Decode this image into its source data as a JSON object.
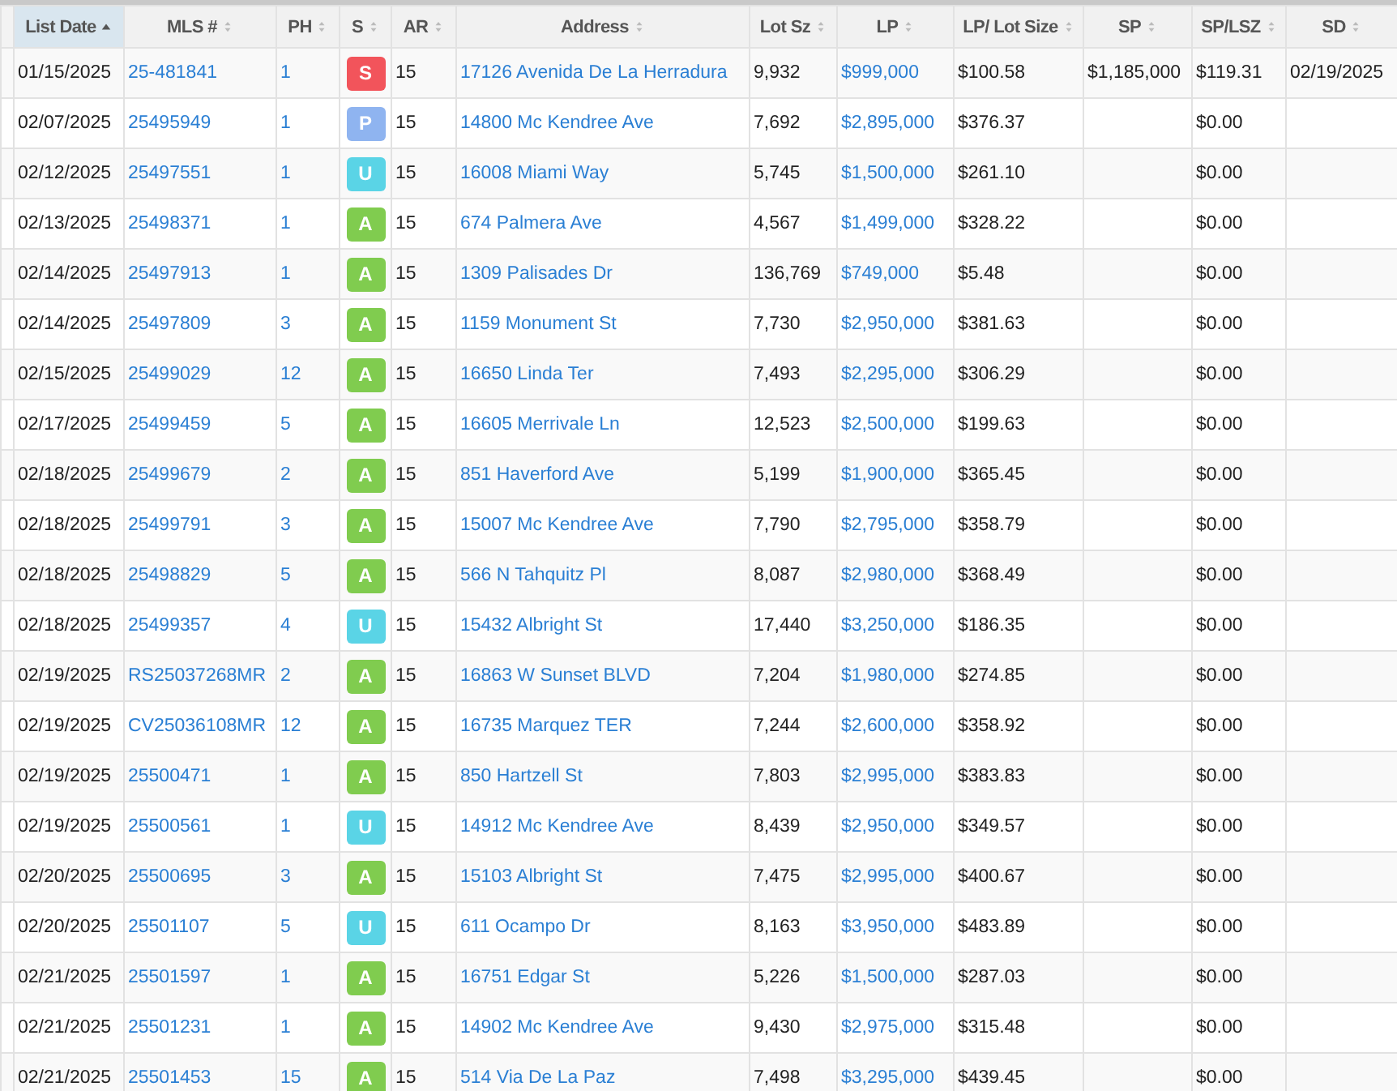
{
  "table": {
    "columns": [
      {
        "label": "List Date",
        "sorted": true
      },
      {
        "label": "MLS #",
        "sorted": false
      },
      {
        "label": "PH",
        "sorted": false
      },
      {
        "label": "S",
        "sorted": false
      },
      {
        "label": "AR",
        "sorted": false
      },
      {
        "label": "Address",
        "sorted": false
      },
      {
        "label": "Lot Sz",
        "sorted": false
      },
      {
        "label": "LP",
        "sorted": false
      },
      {
        "label": "LP/ Lot Size",
        "sorted": false
      },
      {
        "label": "SP",
        "sorted": false
      },
      {
        "label": "SP/LSZ",
        "sorted": false
      },
      {
        "label": "SD",
        "sorted": false
      }
    ],
    "rows": [
      {
        "list_date": "01/15/2025",
        "mls": "25-481841",
        "ph": "1",
        "status": "S",
        "color": "#f2545b",
        "ar": "15",
        "address": "17126 Avenida De La Herradura",
        "lot": "9,932",
        "lp": "$999,000",
        "lp_lot": "$100.58",
        "sp": "$1,185,000",
        "sp_lsz": "$119.31",
        "sd": "02/19/2025"
      },
      {
        "list_date": "02/07/2025",
        "mls": "25495949",
        "ph": "1",
        "status": "P",
        "color": "#8fb4f0",
        "ar": "15",
        "address": "14800 Mc Kendree Ave",
        "lot": "7,692",
        "lp": "$2,895,000",
        "lp_lot": "$376.37",
        "sp_lsz": "$0.00"
      },
      {
        "list_date": "02/12/2025",
        "mls": "25497551",
        "ph": "1",
        "status": "U",
        "color": "#5ad4e6",
        "ar": "15",
        "address": "16008 Miami Way",
        "lot": "5,745",
        "lp": "$1,500,000",
        "lp_lot": "$261.10",
        "sp_lsz": "$0.00"
      },
      {
        "list_date": "02/13/2025",
        "mls": "25498371",
        "ph": "1",
        "status": "A",
        "color": "#80cc4f",
        "ar": "15",
        "address": "674 Palmera Ave",
        "lot": "4,567",
        "lp": "$1,499,000",
        "lp_lot": "$328.22",
        "sp_lsz": "$0.00"
      },
      {
        "list_date": "02/14/2025",
        "mls": "25497913",
        "ph": "1",
        "status": "A",
        "color": "#80cc4f",
        "ar": "15",
        "address": "1309 Palisades Dr",
        "lot": "136,769",
        "lp": "$749,000",
        "lp_lot": "$5.48",
        "sp_lsz": "$0.00"
      },
      {
        "list_date": "02/14/2025",
        "mls": "25497809",
        "ph": "3",
        "status": "A",
        "color": "#80cc4f",
        "ar": "15",
        "address": "1159 Monument St",
        "lot": "7,730",
        "lp": "$2,950,000",
        "lp_lot": "$381.63",
        "sp_lsz": "$0.00"
      },
      {
        "list_date": "02/15/2025",
        "mls": "25499029",
        "ph": "12",
        "status": "A",
        "color": "#80cc4f",
        "ar": "15",
        "address": "16650 Linda Ter",
        "lot": "7,493",
        "lp": "$2,295,000",
        "lp_lot": "$306.29",
        "sp_lsz": "$0.00"
      },
      {
        "list_date": "02/17/2025",
        "mls": "25499459",
        "ph": "5",
        "status": "A",
        "color": "#80cc4f",
        "ar": "15",
        "address": "16605 Merrivale Ln",
        "lot": "12,523",
        "lp": "$2,500,000",
        "lp_lot": "$199.63",
        "sp_lsz": "$0.00"
      },
      {
        "list_date": "02/18/2025",
        "mls": "25499679",
        "ph": "2",
        "status": "A",
        "color": "#80cc4f",
        "ar": "15",
        "address": "851 Haverford Ave",
        "lot": "5,199",
        "lp": "$1,900,000",
        "lp_lot": "$365.45",
        "sp_lsz": "$0.00"
      },
      {
        "list_date": "02/18/2025",
        "mls": "25499791",
        "ph": "3",
        "status": "A",
        "color": "#80cc4f",
        "ar": "15",
        "address": "15007 Mc Kendree Ave",
        "lot": "7,790",
        "lp": "$2,795,000",
        "lp_lot": "$358.79",
        "sp_lsz": "$0.00"
      },
      {
        "list_date": "02/18/2025",
        "mls": "25498829",
        "ph": "5",
        "status": "A",
        "color": "#80cc4f",
        "ar": "15",
        "address": "566 N Tahquitz Pl",
        "lot": "8,087",
        "lp": "$2,980,000",
        "lp_lot": "$368.49",
        "sp_lsz": "$0.00"
      },
      {
        "list_date": "02/18/2025",
        "mls": "25499357",
        "ph": "4",
        "status": "U",
        "color": "#5ad4e6",
        "ar": "15",
        "address": "15432 Albright St",
        "lot": "17,440",
        "lp": "$3,250,000",
        "lp_lot": "$186.35",
        "sp_lsz": "$0.00"
      },
      {
        "list_date": "02/19/2025",
        "mls": "RS25037268MR",
        "ph": "2",
        "status": "A",
        "color": "#80cc4f",
        "ar": "15",
        "address": "16863 W Sunset BLVD",
        "lot": "7,204",
        "lp": "$1,980,000",
        "lp_lot": "$274.85",
        "sp_lsz": "$0.00"
      },
      {
        "list_date": "02/19/2025",
        "mls": "CV25036108MR",
        "ph": "12",
        "status": "A",
        "color": "#80cc4f",
        "ar": "15",
        "address": "16735 Marquez TER",
        "lot": "7,244",
        "lp": "$2,600,000",
        "lp_lot": "$358.92",
        "sp_lsz": "$0.00"
      },
      {
        "list_date": "02/19/2025",
        "mls": "25500471",
        "ph": "1",
        "status": "A",
        "color": "#80cc4f",
        "ar": "15",
        "address": "850 Hartzell St",
        "lot": "7,803",
        "lp": "$2,995,000",
        "lp_lot": "$383.83",
        "sp_lsz": "$0.00"
      },
      {
        "list_date": "02/19/2025",
        "mls": "25500561",
        "ph": "1",
        "status": "U",
        "color": "#5ad4e6",
        "ar": "15",
        "address": "14912 Mc Kendree Ave",
        "lot": "8,439",
        "lp": "$2,950,000",
        "lp_lot": "$349.57",
        "sp_lsz": "$0.00"
      },
      {
        "list_date": "02/20/2025",
        "mls": "25500695",
        "ph": "3",
        "status": "A",
        "color": "#80cc4f",
        "ar": "15",
        "address": "15103 Albright St",
        "lot": "7,475",
        "lp": "$2,995,000",
        "lp_lot": "$400.67",
        "sp_lsz": "$0.00"
      },
      {
        "list_date": "02/20/2025",
        "mls": "25501107",
        "ph": "5",
        "status": "U",
        "color": "#5ad4e6",
        "ar": "15",
        "address": "611 Ocampo Dr",
        "lot": "8,163",
        "lp": "$3,950,000",
        "lp_lot": "$483.89",
        "sp_lsz": "$0.00"
      },
      {
        "list_date": "02/21/2025",
        "mls": "25501597",
        "ph": "1",
        "status": "A",
        "color": "#80cc4f",
        "ar": "15",
        "address": "16751 Edgar St",
        "lot": "5,226",
        "lp": "$1,500,000",
        "lp_lot": "$287.03",
        "sp_lsz": "$0.00"
      },
      {
        "list_date": "02/21/2025",
        "mls": "25501231",
        "ph": "1",
        "status": "A",
        "color": "#80cc4f",
        "ar": "15",
        "address": "14902 Mc Kendree Ave",
        "lot": "9,430",
        "lp": "$2,975,000",
        "lp_lot": "$315.48",
        "sp_lsz": "$0.00"
      },
      {
        "list_date": "02/21/2025",
        "mls": "25501453",
        "ph": "15",
        "status": "A",
        "color": "#80cc4f",
        "ar": "15",
        "address": "514 Via De La Paz",
        "lot": "7,498",
        "lp": "$3,295,000",
        "lp_lot": "$439.45",
        "sp_lsz": "$0.00"
      }
    ]
  }
}
